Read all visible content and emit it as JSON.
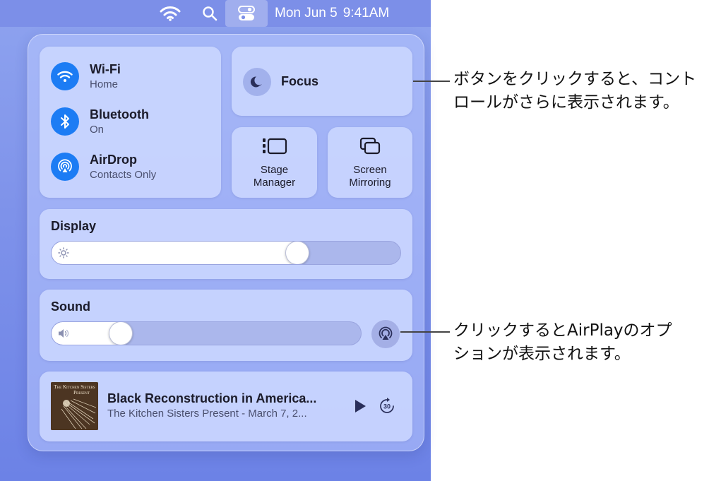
{
  "menubar": {
    "date": "Mon Jun 5",
    "time": "9:41AM",
    "icons": [
      "wifi-icon",
      "search-icon",
      "control-center-icon"
    ]
  },
  "network": {
    "wifi": {
      "title": "Wi-Fi",
      "subtitle": "Home",
      "icon": "wifi-icon"
    },
    "bluetooth": {
      "title": "Bluetooth",
      "subtitle": "On",
      "icon": "bluetooth-icon"
    },
    "airdrop": {
      "title": "AirDrop",
      "subtitle": "Contacts Only",
      "icon": "airdrop-icon"
    }
  },
  "focus": {
    "label": "Focus",
    "icon": "moon-icon"
  },
  "stage_manager": {
    "label_line1": "Stage",
    "label_line2": "Manager",
    "icon": "stage-manager-icon"
  },
  "screen_mirroring": {
    "label_line1": "Screen",
    "label_line2": "Mirroring",
    "icon": "screen-mirroring-icon"
  },
  "display": {
    "title": "Display",
    "level": 0.72,
    "icon": "sun-icon"
  },
  "sound": {
    "title": "Sound",
    "level": 0.2,
    "icon": "speaker-icon",
    "airplay_icon": "airplay-audio-icon"
  },
  "now_playing": {
    "album_text_line1": "The Kitchen Sisters",
    "album_text_line2": "Present",
    "title": "Black Reconstruction in America...",
    "subtitle": "The Kitchen Sisters Present - March 7, 2...",
    "play_icon": "play-icon",
    "skip_icon": "skip-forward-30-icon",
    "skip_value": "30"
  },
  "callouts": {
    "controls_line1": "ボタンをクリックすると、コント",
    "controls_line2": "ロールがさらに表示されます。",
    "airplay_line1": "クリックするとAirPlayのオプ",
    "airplay_line2": "ションが表示されます。"
  },
  "colors": {
    "accent_blue": "#1c7cf4",
    "desktop": "#7e92ea"
  }
}
